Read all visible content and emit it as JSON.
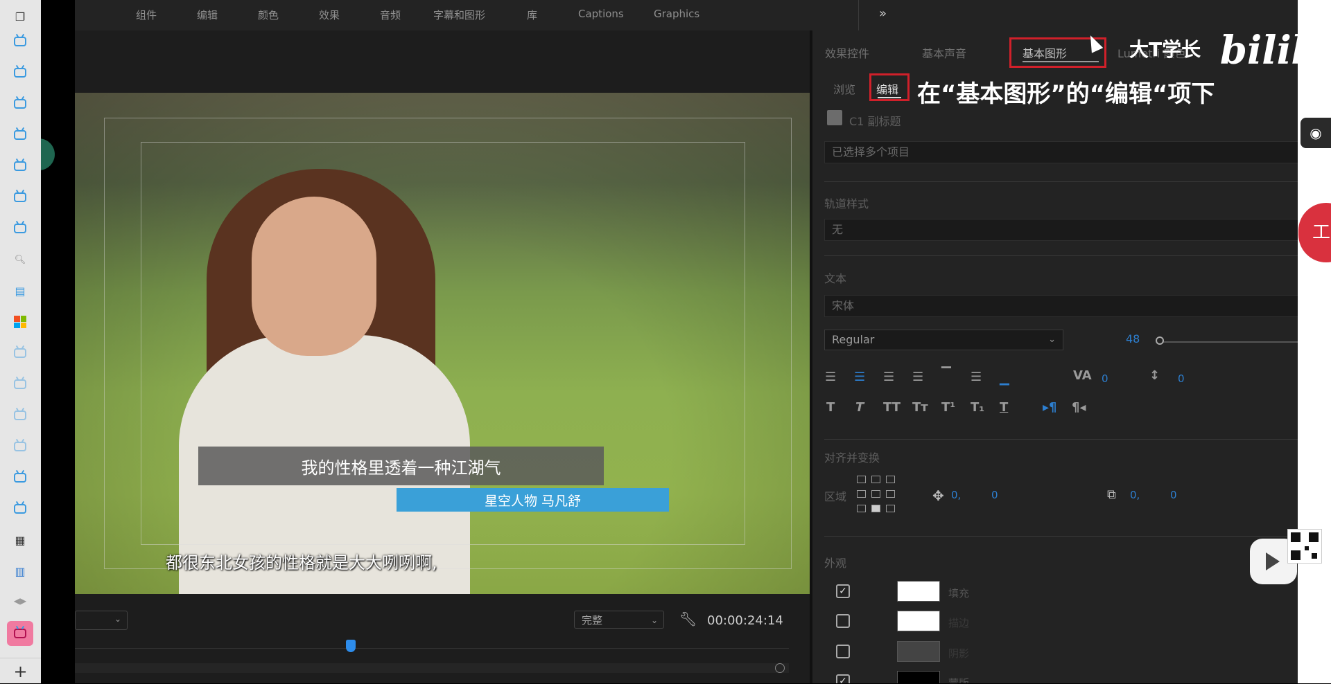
{
  "premiere_menu": {
    "items": [
      "组件",
      "编辑",
      "颜色",
      "效果",
      "音频",
      "字幕和图形",
      "库",
      "Captions",
      "Graphics"
    ],
    "more": "»"
  },
  "monitor": {
    "subtitle_main": "我的性格里透着一种江湖气",
    "subtitle_name": "星空人物  马凡舒",
    "subtitle_bottom": "都很东北女孩的性格就是大大咧咧啊,",
    "quality": "完整",
    "timecode": "00:00:24:14",
    "playhead_fraction": 0.38
  },
  "panel": {
    "tabs": [
      "效果控件",
      "基本声音",
      "基本图形",
      "Lumetri 颜色"
    ],
    "subtabs": [
      "浏览",
      "编辑"
    ],
    "annotation": "在“基本图形”的“编辑“项下",
    "layer_name": "C1 副标题",
    "selection_field": "已选择多个项目",
    "track_style_label": "轨道样式",
    "track_style_value": "无",
    "text_label": "文本",
    "font_value": "宋体",
    "font_style": "Regular",
    "font_size": "48",
    "font_size_fraction": 0.0,
    "tracking": "0",
    "leading": "0",
    "align_label": "对齐并变换",
    "area_label": "区域",
    "position_x": "0,",
    "position_y": "0",
    "scale_x": "0,",
    "scale_y": "0",
    "appearance_label": "外观",
    "fill_label": "填充",
    "stroke_label": "描边",
    "shadow_label": "阴影",
    "mask_label": "蒙版",
    "colors": {
      "fill": "#ffffff",
      "stroke": "#ffffff",
      "shadow": "#444444",
      "mask": "#000000"
    }
  },
  "watermark": {
    "uploader": "大T学长",
    "brand": "bilibili"
  },
  "right_tools": {
    "tool_button": "工具"
  },
  "sidebar": {
    "add": "+"
  },
  "colors": {
    "accent_red": "#d0202a",
    "accent_blue": "#2d7fd0",
    "bili_pink": "#f07aa0"
  }
}
